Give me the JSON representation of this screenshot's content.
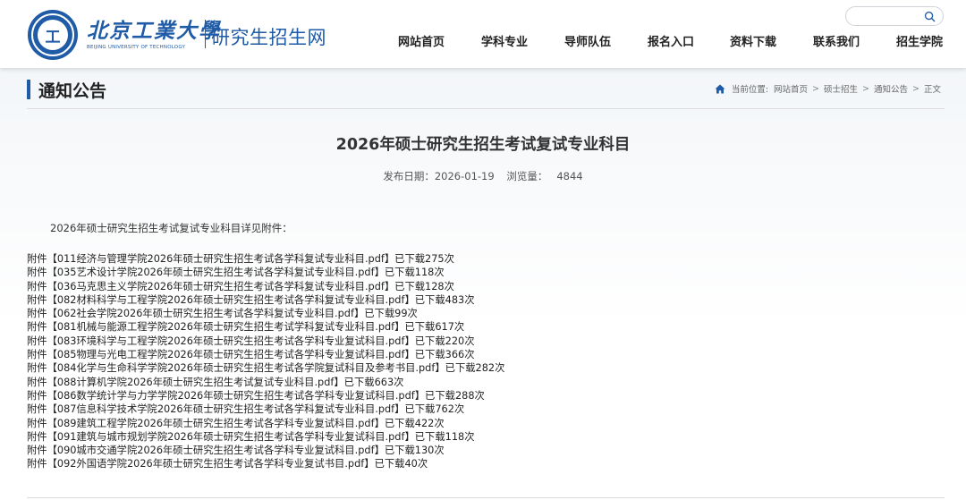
{
  "header": {
    "logo_emblem_text": "工",
    "logo_name_cn": "北京工業大學",
    "logo_name_en": "BEIJING UNIVERSITY OF TECHNOLOGY",
    "site_name": "研究生招生网",
    "search": {
      "value": "",
      "placeholder": ""
    },
    "search_icon": "search-icon",
    "nav": [
      {
        "label": "网站首页"
      },
      {
        "label": "学科专业"
      },
      {
        "label": "导师队伍"
      },
      {
        "label": "报名入口"
      },
      {
        "label": "资料下载"
      },
      {
        "label": "联系我们"
      },
      {
        "label": "招生学院"
      }
    ]
  },
  "section": {
    "title": "通知公告",
    "breadcrumb": {
      "home_icon": "home-icon",
      "prefix": "当前位置:",
      "items": [
        "网站首页",
        "硕士招生",
        "通知公告",
        "正文"
      ],
      "separator": ">"
    }
  },
  "article": {
    "title": "2026年硕士研究生招生考试复试专业科目",
    "publish_label": "发布日期：",
    "publish_date": "2026-01-19",
    "views_label": "浏览量：",
    "views": "4844",
    "intro": "2026年硕士研究生招生考试复试专业科目详见附件：",
    "attachments": [
      {
        "prefix": "附件【",
        "file": "011经济与管理学院2026年硕士研究生招生考试各学科复试专业科目.pdf",
        "suffix": "】已下载275次"
      },
      {
        "prefix": "附件【",
        "file": "035艺术设计学院2026年硕士研究生招生考试各学科复试专业科目.pdf",
        "suffix": "】已下载118次"
      },
      {
        "prefix": "附件【",
        "file": "036马克思主义学院2026年硕士研究生招生考试各学科复试专业科目.pdf",
        "suffix": "】已下载128次"
      },
      {
        "prefix": "附件【",
        "file": "082材料科学与工程学院2026年硕士研究生招生考试各学科复试专业科目.pdf",
        "suffix": "】已下载483次"
      },
      {
        "prefix": "附件【",
        "file": "062社会学院2026年硕士研究生招生考试各学科复试专业科目.pdf",
        "suffix": "】已下载99次"
      },
      {
        "prefix": "附件【",
        "file": "081机械与能源工程学院2026年硕士研究生招生考试学科复试专业科目.pdf",
        "suffix": "】已下载617次"
      },
      {
        "prefix": "附件【",
        "file": "083环境科学与工程学院2026年硕士研究生招生考试各学科专业复试科目.pdf",
        "suffix": "】已下载220次"
      },
      {
        "prefix": "附件【",
        "file": "085物理与光电工程学院2026年硕士研究生招生考试各学科专业复试科目.pdf",
        "suffix": "】已下载366次"
      },
      {
        "prefix": "附件【",
        "file": "084化学与生命科学学院2026年硕士研究生招生考试各学院复试科目及参考书目.pdf",
        "suffix": "】已下载282次"
      },
      {
        "prefix": "附件【",
        "file": "088计算机学院2026年硕士研究生招生考试复试专业科目.pdf",
        "suffix": "】已下载663次"
      },
      {
        "prefix": "附件【",
        "file": "086数学统计学与力学学院2026年硕士研究生招生考试各学科专业复试科目.pdf",
        "suffix": "】已下载288次"
      },
      {
        "prefix": "附件【",
        "file": "087信息科学技术学院2026年硕士研究生招生考试各学科复试专业科目.pdf",
        "suffix": "】已下载762次"
      },
      {
        "prefix": "附件【",
        "file": "089建筑工程学院2026年硕士研究生招生考试各学科专业复试科目.pdf",
        "suffix": "】已下载422次"
      },
      {
        "prefix": "附件【",
        "file": "091建筑与城市规划学院2026年硕士研究生招生考试各学科专业复试科目.pdf",
        "suffix": "】已下载118次"
      },
      {
        "prefix": "附件【",
        "file": "090城市交通学院2026年硕士研究生招生考试各学科专业复试科目.pdf",
        "suffix": "】已下载130次"
      },
      {
        "prefix": "附件【",
        "file": "092外国语学院2026年硕士研究生招生考试各学科专业复试书目.pdf",
        "suffix": "】已下载40次"
      }
    ]
  },
  "colors": {
    "brand_blue": "#1f5ba6",
    "text_dark": "#222222"
  }
}
